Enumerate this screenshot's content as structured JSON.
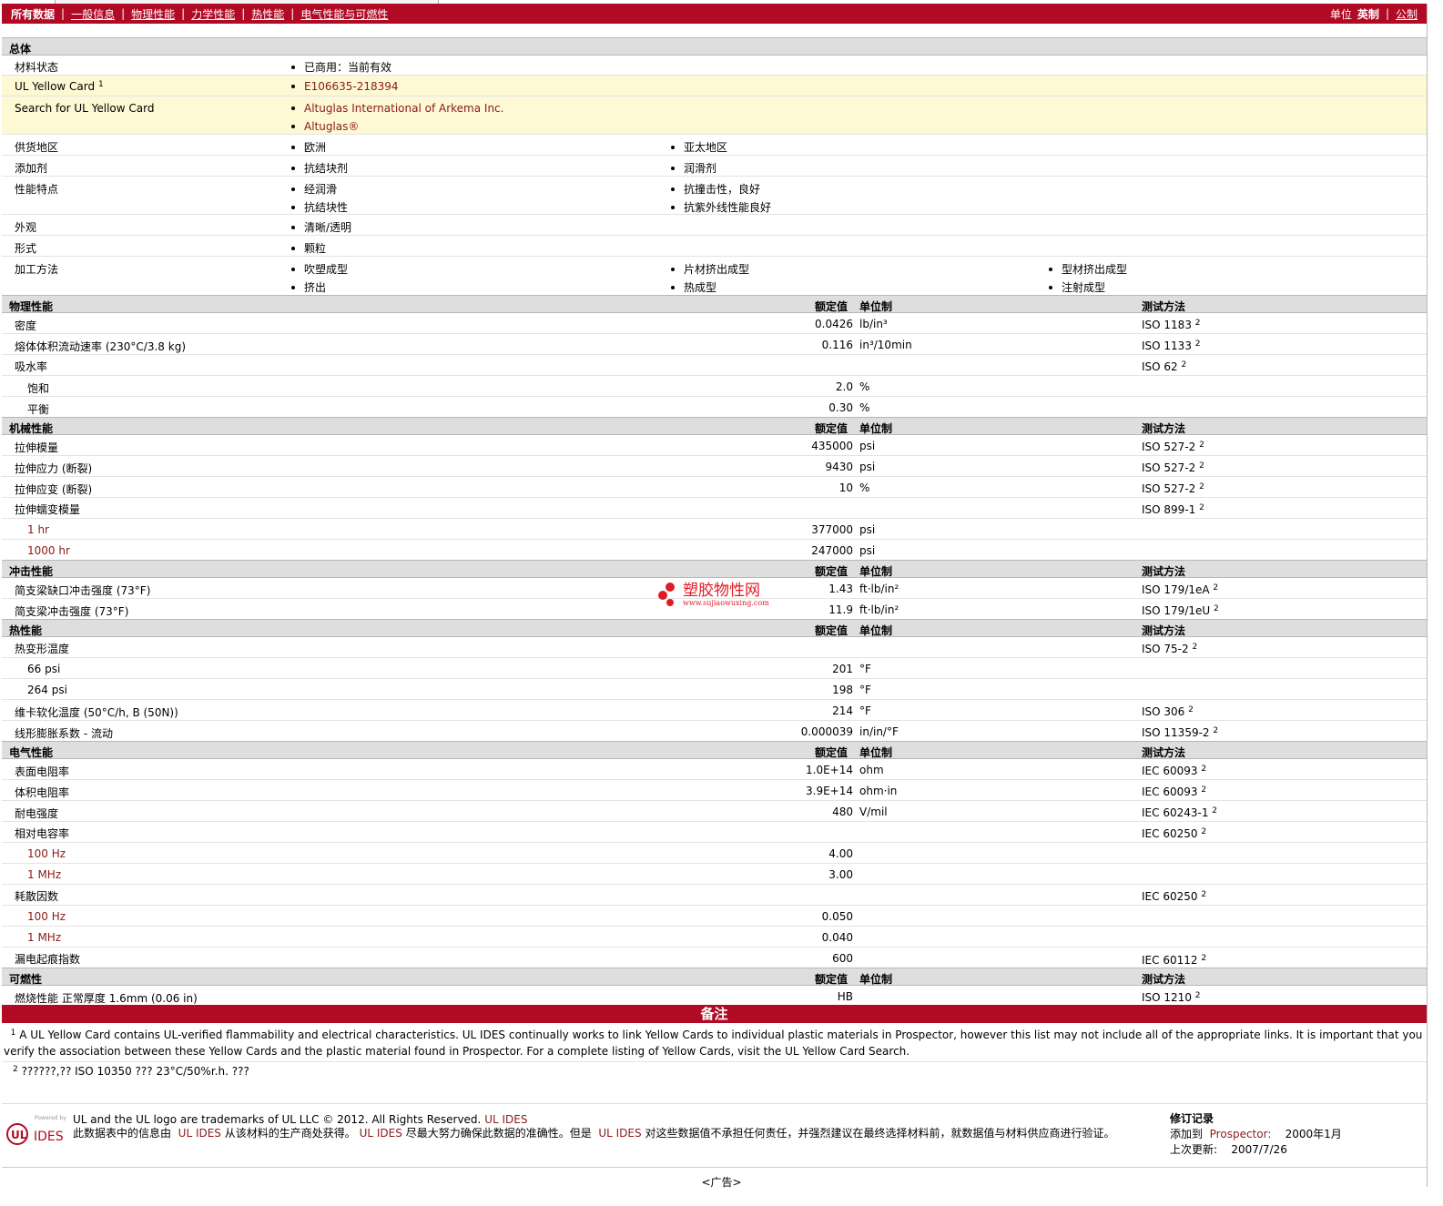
{
  "topbar": {
    "tabs": [
      "所有数据",
      "一般信息",
      "物理性能",
      "力学性能",
      "热性能",
      "电气性能与可燃性"
    ],
    "units_label": "单位",
    "unit_active": "英制",
    "unit_other": "公制"
  },
  "general": {
    "title": "总体",
    "material_status": {
      "label": "材料状态",
      "value": "已商用：当前有效"
    },
    "ul_card": {
      "label": "UL Yellow Card",
      "sup": "1",
      "value": "E106635-218394"
    },
    "ul_search": {
      "label": "Search for UL Yellow Card",
      "values": [
        "Altuglas International of Arkema Inc.",
        "Altuglas®"
      ]
    },
    "supply": {
      "label": "供货地区",
      "values": [
        "欧洲",
        "亚太地区"
      ]
    },
    "additive": {
      "label": "添加剂",
      "values": [
        "抗结块剂",
        "润滑剂"
      ]
    },
    "features": {
      "label": "性能特点",
      "values": [
        "经润滑",
        "抗结块性",
        "抗撞击性，良好",
        "抗紫外线性能良好"
      ]
    },
    "appearance": {
      "label": "外观",
      "value": "清晰/透明"
    },
    "form": {
      "label": "形式",
      "value": "颗粒"
    },
    "processing": {
      "label": "加工方法",
      "values": [
        "吹塑成型",
        "挤出",
        "片材挤出成型",
        "热成型",
        "型材挤出成型",
        "注射成型"
      ]
    }
  },
  "headers": {
    "rated": "额定值",
    "unit": "单位制",
    "test": "测试方法"
  },
  "physical": {
    "title": "物理性能",
    "density": {
      "label": "密度",
      "value": "0.0426",
      "unit": "lb/in³",
      "test": "ISO 1183",
      "sup": "2"
    },
    "mvr": {
      "label": "熔体体积流动速率",
      "cond": "(230°C/3.8 kg)",
      "value": "0.116",
      "unit": "in³/10min",
      "test": "ISO 1133",
      "sup": "2"
    },
    "water": {
      "label": "吸水率",
      "test": "ISO 62",
      "sup": "2"
    },
    "saturated": {
      "label": "饱和",
      "value": "2.0",
      "unit": "%"
    },
    "equilibrium": {
      "label": "平衡",
      "value": "0.30",
      "unit": "%"
    }
  },
  "mechanical": {
    "title": "机械性能",
    "modulus": {
      "label": "拉伸模量",
      "value": "435000",
      "unit": "psi",
      "test": "ISO 527-2",
      "sup": "2"
    },
    "stress": {
      "label": "拉伸应力",
      "cond": "(断裂)",
      "value": "9430",
      "unit": "psi",
      "test": "ISO 527-2",
      "sup": "2"
    },
    "strain": {
      "label": "拉伸应变",
      "cond": "(断裂)",
      "value": "10",
      "unit": "%",
      "test": "ISO 527-2",
      "sup": "2"
    },
    "creep": {
      "label": "拉伸蠕变模量",
      "test": "ISO 899-1",
      "sup": "2"
    },
    "creep_1h": {
      "label": "1 hr",
      "value": "377000",
      "unit": "psi"
    },
    "creep_1000h": {
      "label": "1000 hr",
      "value": "247000",
      "unit": "psi"
    }
  },
  "impact": {
    "title": "冲击性能",
    "notched": {
      "label": "简支梁缺口冲击强度",
      "cond": "(73°F)",
      "value": "1.43",
      "unit": "ft·lb/in²",
      "test": "ISO 179/1eA",
      "sup": "2"
    },
    "unnotched": {
      "label": "简支梁冲击强度",
      "cond": "(73°F)",
      "value": "11.9",
      "unit": "ft·lb/in²",
      "test": "ISO 179/1eU",
      "sup": "2"
    }
  },
  "watermark": {
    "name": "塑胶物性网",
    "url": "www.sujiaowuxing.com"
  },
  "thermal": {
    "title": "热性能",
    "hdt": {
      "label": "热变形温度",
      "test": "ISO 75-2",
      "sup": "2"
    },
    "hdt_66": {
      "label": "66 psi",
      "value": "201",
      "unit": "°F"
    },
    "hdt_264": {
      "label": "264 psi",
      "value": "198",
      "unit": "°F"
    },
    "vicat": {
      "label": "维卡软化温度",
      "cond": "(50°C/h, B (50N))",
      "value": "214",
      "unit": "°F",
      "test": "ISO 306",
      "sup": "2"
    },
    "clte": {
      "label": "线形膨胀系数",
      "cond": "- 流动",
      "value": "0.000039",
      "unit": "in/in/°F",
      "test": "ISO 11359-2",
      "sup": "2"
    }
  },
  "electrical": {
    "title": "电气性能",
    "surface": {
      "label": "表面电阻率",
      "value": "1.0E+14",
      "unit": "ohm",
      "test": "IEC 60093",
      "sup": "2"
    },
    "volume": {
      "label": "体积电阻率",
      "value": "3.9E+14",
      "unit": "ohm·in",
      "test": "IEC 60093",
      "sup": "2"
    },
    "dielectric_strength": {
      "label": "耐电强度",
      "value": "480",
      "unit": "V/mil",
      "test": "IEC 60243-1",
      "sup": "2"
    },
    "permittivity": {
      "label": "相对电容率",
      "test": "IEC 60250",
      "sup": "2"
    },
    "perm_100": {
      "label": "100 Hz",
      "value": "4.00"
    },
    "perm_1m": {
      "label": "1 MHz",
      "value": "3.00"
    },
    "dissipation": {
      "label": "耗散因数",
      "test": "IEC 60250",
      "sup": "2"
    },
    "diss_100": {
      "label": "100 Hz",
      "value": "0.050"
    },
    "diss_1m": {
      "label": "1 MHz",
      "value": "0.040"
    },
    "cti": {
      "label": "漏电起痕指数",
      "value": "600",
      "test": "IEC 60112",
      "sup": "2"
    }
  },
  "flammability": {
    "title": "可燃性",
    "burn": {
      "label": "燃烧性能",
      "cond_label": "正常厚度",
      "cond": "1.6mm (0.06 in)",
      "value": "HB",
      "test": "ISO 1210",
      "sup": "2"
    }
  },
  "notes": {
    "title": "备注",
    "n1_sup": "1",
    "n1": "A UL Yellow Card contains UL-verified flammability and electrical characteristics. UL IDES continually works to link Yellow Cards to individual plastic materials in Prospector, however this list may not include all of the appropriate links. It is important that you verify the association between these Yellow Cards and the plastic material found in Prospector. For a complete listing of Yellow Cards, visit the UL Yellow Card Search.",
    "n2_sup": "2",
    "n2": "??????,?? ISO 10350 ??? 23°C/50%r.h. ???"
  },
  "footer": {
    "logo_powered": "Powered by",
    "logo_ul": "UL",
    "logo_ides": "IDES",
    "line1": "UL and the UL logo are trademarks of UL LLC © 2012. All Rights Reserved.",
    "line1_link": "UL IDES",
    "line2_a": "此数据表中的信息由",
    "line2_b": "UL IDES",
    "line2_c": "从该材料的生产商处获得。",
    "line2_d": "UL IDES",
    "line2_e": "尽最大努力确保此数据的准确性。但是",
    "line2_f": "UL IDES",
    "line2_g": "对这些数据值不承担任何责任，并强烈建议在最终选择材料前，就数据值与材料供应商进行验证。",
    "rev_title": "修订记录",
    "added_label": "添加到",
    "added_where": "Prospector:",
    "added_date": "2000年1月",
    "updated_label": "上次更新:",
    "updated_date": "2007/7/26"
  },
  "ad": "<广告>"
}
